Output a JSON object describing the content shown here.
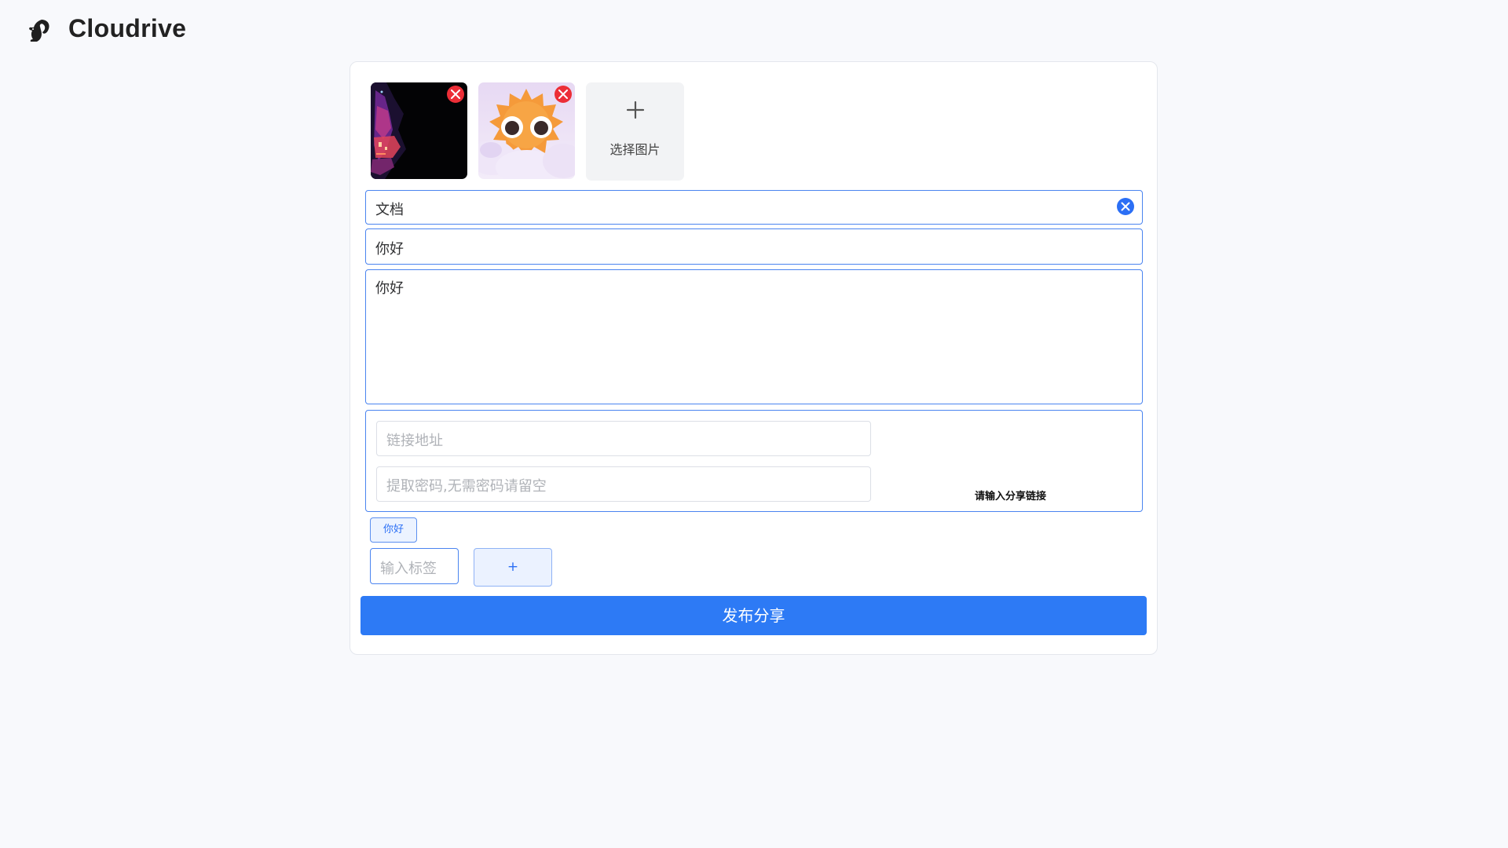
{
  "app": {
    "title": "Cloudrive",
    "logo_icon": "squirrel-icon"
  },
  "images": {
    "thumbnails": [
      {
        "description_icon": "neon-city-image",
        "remove_icon": "close-icon"
      },
      {
        "description_icon": "sun-emoji-image",
        "remove_icon": "close-icon"
      }
    ],
    "picker_label": "选择图片",
    "picker_icon": "plus-icon"
  },
  "form": {
    "category_value": "文档",
    "title_value": "你好",
    "description_value": "你好",
    "link_placeholder": "链接地址",
    "password_placeholder": "提取密码,无需密码请留空",
    "link_hint": "请输入分享链接",
    "tags": [
      "你好"
    ],
    "tag_input_placeholder": "输入标签",
    "add_tag_label": "+",
    "submit_label": "发布分享"
  },
  "colors": {
    "accent": "#2d7af5",
    "remove": "#ec2e37",
    "border": "#4a84f0",
    "background": "#f8f9fc"
  }
}
